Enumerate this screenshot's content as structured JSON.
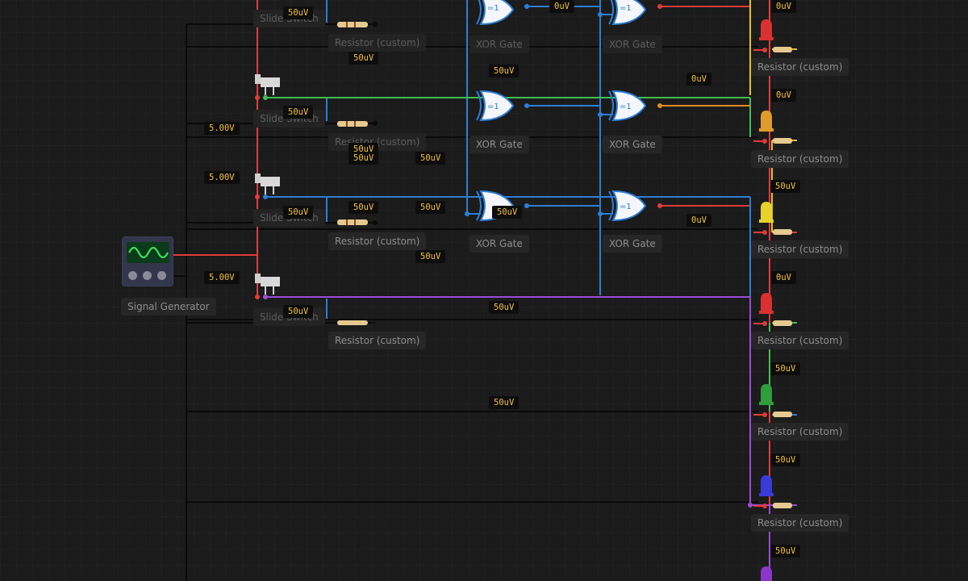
{
  "labels": {
    "signal_generator": "Signal Generator",
    "slide_switch": "Slide Switch",
    "resistor": "Resistor (custom)",
    "xor_gate": "XOR Gate",
    "xor_symbol": "=1"
  },
  "readings": {
    "v_50uV": "50uV",
    "v_0uV": "0uV",
    "v_5V": "5.00V"
  },
  "colors": {
    "red": "#e03a3a",
    "green": "#3fbf52",
    "blue": "#2d7fd6",
    "orange": "#e28a24",
    "yellow": "#e8c020",
    "purple": "#9b4bd6",
    "black": "#0b0b0b",
    "background": "#1b1b1c"
  },
  "leds": [
    {
      "color": "#d93030",
      "reading": "0uV"
    },
    {
      "color": "#e09c2a",
      "reading": "0uV"
    },
    {
      "color": "#e6d22a",
      "reading": "50uV"
    },
    {
      "color": "#d93030",
      "reading": "0uV"
    },
    {
      "color": "#2f9e3a",
      "reading": "50uV"
    },
    {
      "color": "#3a3ad9",
      "reading": "50uV"
    },
    {
      "color": "#8a36c8",
      "reading": "50uV"
    }
  ]
}
